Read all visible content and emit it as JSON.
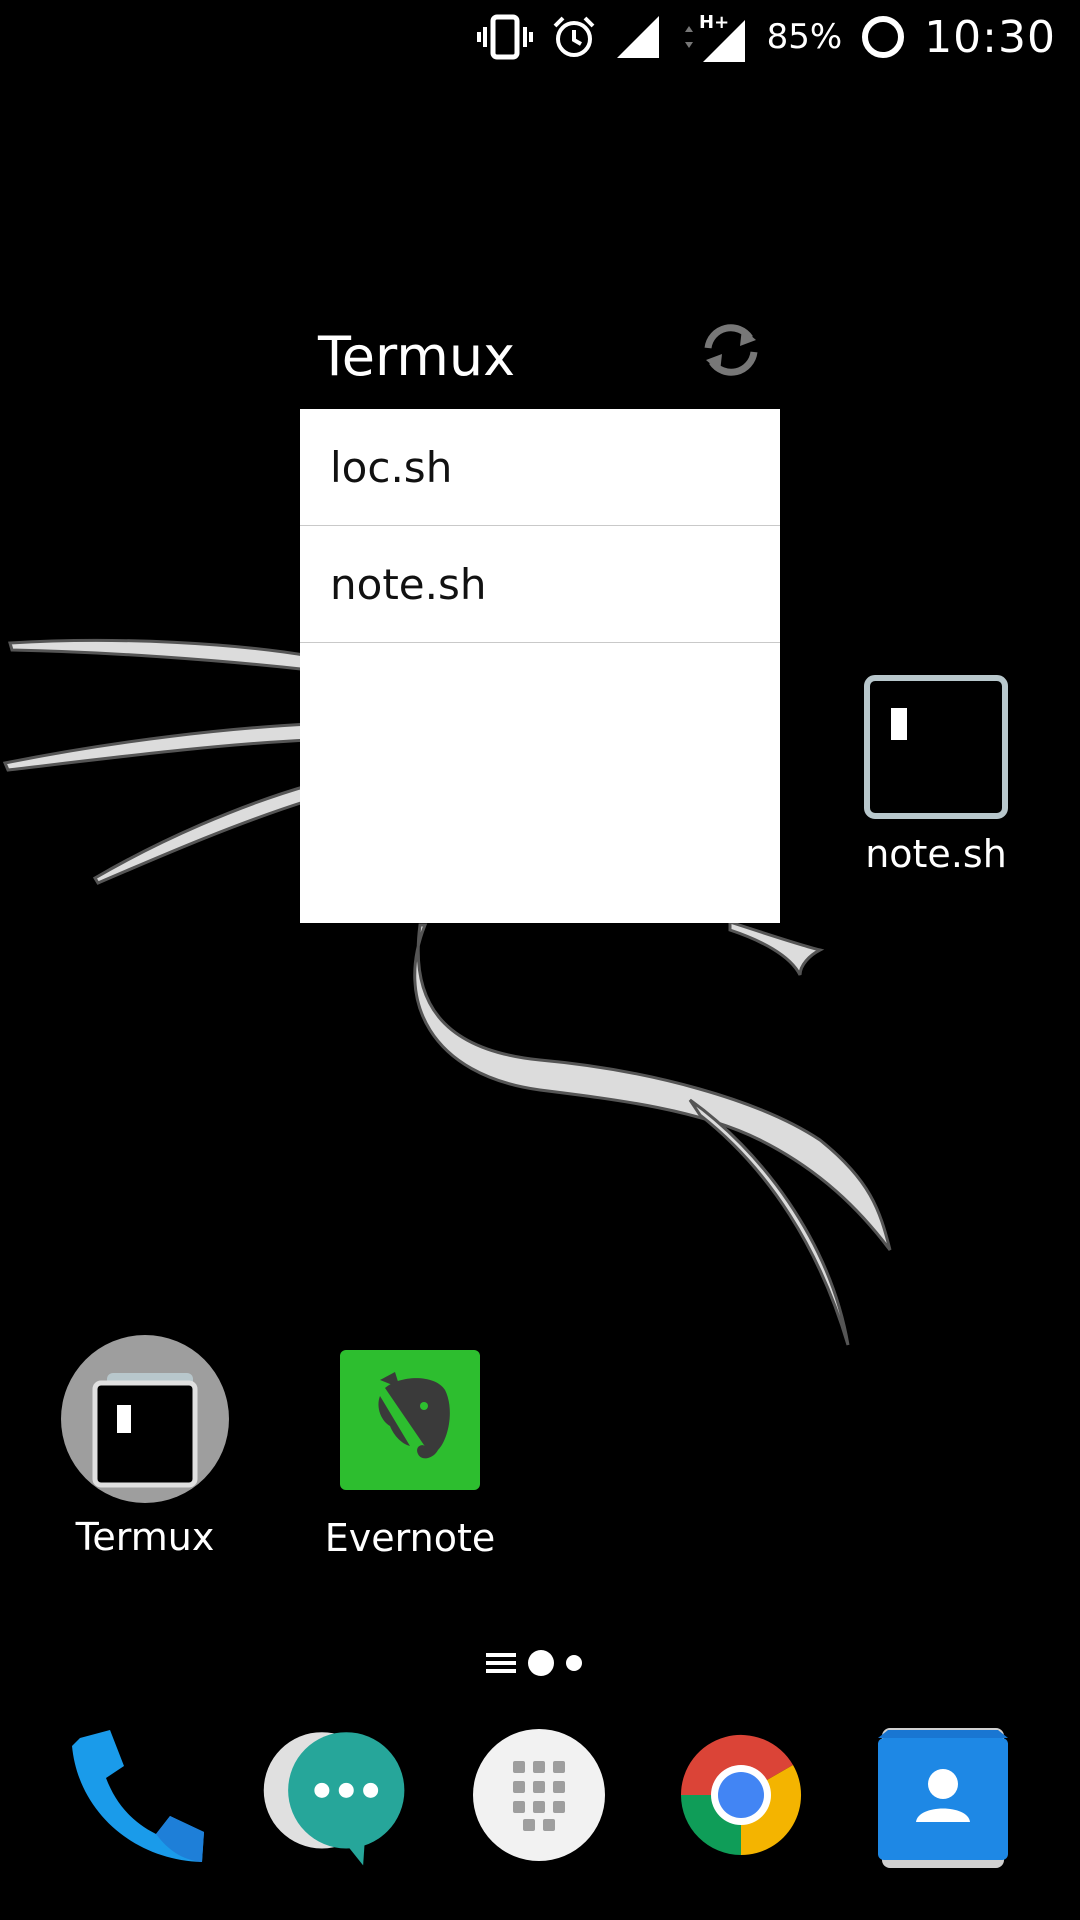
{
  "status_bar": {
    "battery_percent": "85%",
    "time": "10:30",
    "network_type": "H+",
    "icons": [
      "vibrate-icon",
      "alarm-icon",
      "signal-icon",
      "data-arrows-icon",
      "signal-h-plus-icon",
      "battery-ring-icon"
    ]
  },
  "widget": {
    "title": "Termux",
    "refresh_icon": "refresh-icon",
    "items": [
      {
        "label": "loc.sh"
      },
      {
        "label": "note.sh"
      }
    ]
  },
  "desktop_shortcuts": {
    "note_sh": {
      "label": "note.sh",
      "icon": "terminal-icon"
    },
    "termux": {
      "label": "Termux",
      "icon": "termux-icon"
    },
    "evernote": {
      "label": "Evernote",
      "icon": "evernote-icon"
    }
  },
  "dock": {
    "apps": [
      "phone-icon",
      "messaging-icon",
      "app-drawer-icon",
      "chrome-icon",
      "contacts-icon"
    ]
  },
  "colors": {
    "background": "#000000",
    "evernote_green": "#2dbe2f",
    "phone_blue": "#1a9bea",
    "messaging_teal": "#26a69a",
    "contacts_blue": "#1e88e5"
  }
}
